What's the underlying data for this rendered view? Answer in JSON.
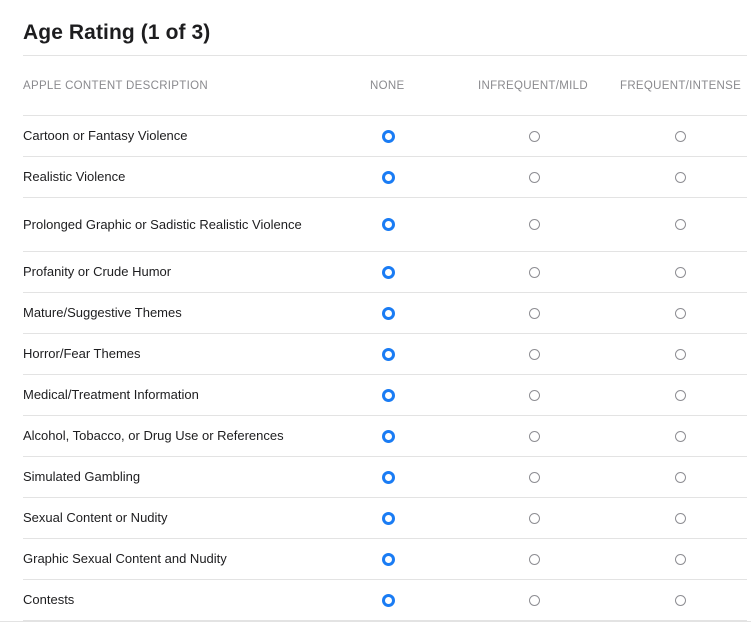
{
  "page": {
    "title": "Age Rating (1 of 3)"
  },
  "table": {
    "headers": {
      "description": "APPLE CONTENT DESCRIPTION",
      "none": "NONE",
      "infrequent_mild": "INFREQUENT/MILD",
      "frequent_intense": "FREQUENT/INTENSE"
    },
    "rows": [
      {
        "label": "Cartoon or Fantasy Violence",
        "selected": "none"
      },
      {
        "label": "Realistic Violence",
        "selected": "none"
      },
      {
        "label": "Prolonged Graphic or Sadistic Realistic Violence",
        "selected": "none"
      },
      {
        "label": "Profanity or Crude Humor",
        "selected": "none"
      },
      {
        "label": "Mature/Suggestive Themes",
        "selected": "none"
      },
      {
        "label": "Horror/Fear Themes",
        "selected": "none"
      },
      {
        "label": "Medical/Treatment Information",
        "selected": "none"
      },
      {
        "label": "Alcohol, Tobacco, or Drug Use or References",
        "selected": "none"
      },
      {
        "label": "Simulated Gambling",
        "selected": "none"
      },
      {
        "label": "Sexual Content or Nudity",
        "selected": "none"
      },
      {
        "label": "Graphic Sexual Content and Nudity",
        "selected": "none"
      },
      {
        "label": "Contests",
        "selected": "none"
      }
    ]
  },
  "colors": {
    "accent": "#1a7cf4",
    "header_text": "#8a8a8e",
    "divider": "#e3e3e3",
    "text": "#1d1d1f"
  },
  "icons": {
    "radio_selected": "radio-selected-icon",
    "radio_unselected": "radio-unselected-icon"
  }
}
